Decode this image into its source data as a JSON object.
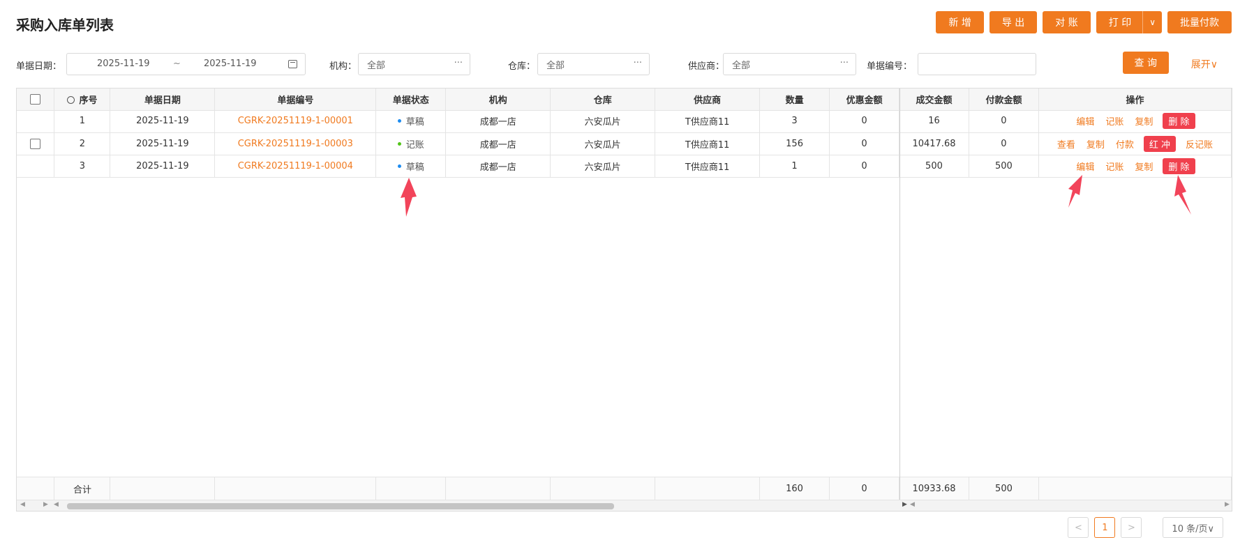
{
  "page_title": "采购入库单列表",
  "toolbar": {
    "add": "新 增",
    "export": "导 出",
    "reconcile": "对 账",
    "print": "打 印",
    "print_caret": "∨",
    "batch_pay": "批量付款"
  },
  "filters": {
    "date_label": "单据日期：",
    "date_start": "2025-11-19",
    "date_sep": "~",
    "date_end": "2025-11-19",
    "org_label": "机构：",
    "org_value": "全部",
    "warehouse_label": "仓库：",
    "warehouse_value": "全部",
    "supplier_label": "供应商：",
    "supplier_value": "全部",
    "docno_label": "单据编号：",
    "docno_value": "",
    "query_button": "查 询",
    "expand": "展开∨",
    "more": "···"
  },
  "table": {
    "columns": [
      "序号",
      "单据日期",
      "单据编号",
      "单据状态",
      "机构",
      "仓库",
      "供应商",
      "数量",
      "优惠金额",
      "成交金额",
      "付款金额",
      "操作"
    ],
    "rows": [
      {
        "no": "1",
        "date": "2025-11-19",
        "docno": "CGRK-20251119-1-00001",
        "status": "草稿",
        "status_color": "#1e8cf0",
        "org": "成都一店",
        "warehouse": "六安瓜片",
        "supplier": "T供应商11",
        "qty": "3",
        "discount": "0",
        "amount": "16",
        "paid": "0",
        "ops": [
          {
            "label": "编辑",
            "danger": false
          },
          {
            "label": "记账",
            "danger": false
          },
          {
            "label": "复制",
            "danger": false
          },
          {
            "label": "删 除",
            "danger": true
          }
        ]
      },
      {
        "no": "2",
        "date": "2025-11-19",
        "docno": "CGRK-20251119-1-00003",
        "status": "记账",
        "status_color": "#52c41a",
        "org": "成都一店",
        "warehouse": "六安瓜片",
        "supplier": "T供应商11",
        "qty": "156",
        "discount": "0",
        "amount": "10417.68",
        "paid": "0",
        "ops": [
          {
            "label": "查看",
            "danger": false
          },
          {
            "label": "复制",
            "danger": false
          },
          {
            "label": "付款",
            "danger": false
          },
          {
            "label": "红 冲",
            "danger": true
          },
          {
            "label": "反记账",
            "danger": false
          }
        ]
      },
      {
        "no": "3",
        "date": "2025-11-19",
        "docno": "CGRK-20251119-1-00004",
        "status": "草稿",
        "status_color": "#1e8cf0",
        "org": "成都一店",
        "warehouse": "六安瓜片",
        "supplier": "T供应商11",
        "qty": "1",
        "discount": "0",
        "amount": "500",
        "paid": "500",
        "ops": [
          {
            "label": "编辑",
            "danger": false
          },
          {
            "label": "记账",
            "danger": false
          },
          {
            "label": "复制",
            "danger": false
          },
          {
            "label": "删 除",
            "danger": true
          }
        ]
      }
    ],
    "footer": {
      "label": "合计",
      "qty": "160",
      "discount": "0",
      "amount": "10933.68",
      "paid": "500"
    }
  },
  "pager": {
    "prev": "<",
    "current": "1",
    "next": ">",
    "page_size": "10 条/页∨"
  },
  "colors": {
    "accent": "#f07a1f",
    "danger": "#f0404d",
    "annotation_arrow": "#f2445a"
  }
}
